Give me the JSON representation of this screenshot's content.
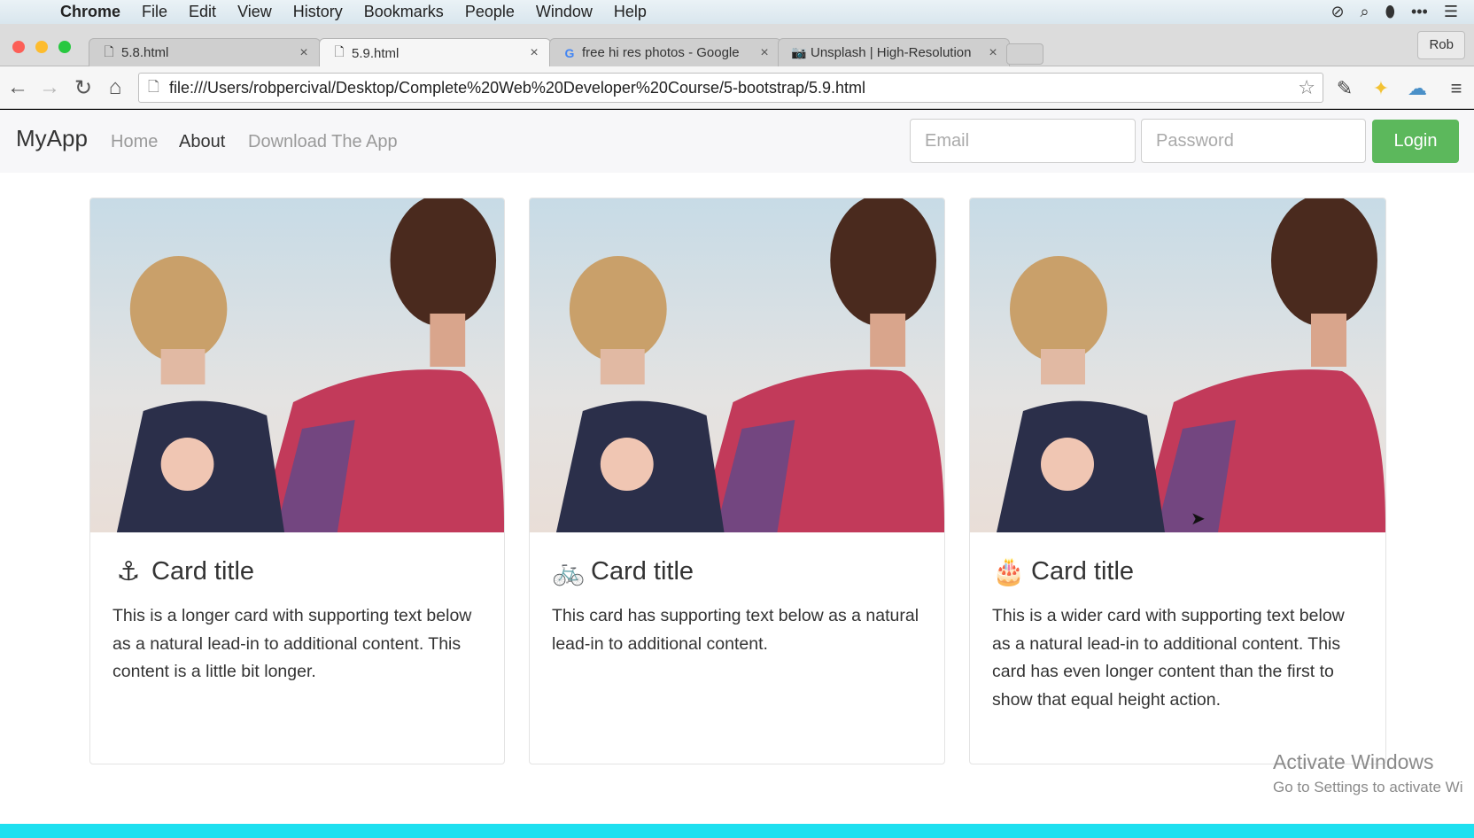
{
  "menubar": {
    "apple": "",
    "app_name": "Chrome",
    "items": [
      "File",
      "Edit",
      "View",
      "History",
      "Bookmarks",
      "People",
      "Window",
      "Help"
    ],
    "status_icons": [
      "⊘",
      "⌕",
      "⬮",
      "•••",
      "☰"
    ]
  },
  "tabs": [
    {
      "title": "5.8.html",
      "favicon": "🗋",
      "active": false
    },
    {
      "title": "5.9.html",
      "favicon": "🗋",
      "active": true
    },
    {
      "title": "free hi res photos - Google",
      "favicon": "G",
      "active": false
    },
    {
      "title": "Unsplash | High-Resolution",
      "favicon": "📷",
      "active": false
    }
  ],
  "tab_close": "×",
  "profile_name": "Rob",
  "toolbar": {
    "back": "←",
    "forward": "→",
    "reload": "↻",
    "home": "⌂",
    "page_icon": "🗋",
    "url": "file:///Users/robpercival/Desktop/Complete%20Web%20Developer%20Course/5-bootstrap/5.9.html",
    "star": "☆",
    "ext_icons": [
      "✎",
      "✦",
      "☁",
      "≡"
    ]
  },
  "site": {
    "brand": "MyApp",
    "nav": [
      "Home",
      "About",
      "Download The App"
    ],
    "email_placeholder": "Email",
    "password_placeholder": "Password",
    "login": "Login"
  },
  "cards": [
    {
      "icon": "⚓",
      "title": "Card title",
      "text": "This is a longer card with supporting text below as a natural lead-in to additional content. This content is a little bit longer."
    },
    {
      "icon": "🚲",
      "title": "Card title",
      "text": "This card has supporting text below as a natural lead-in to additional content."
    },
    {
      "icon": "🎂",
      "title": "Card title",
      "text": "This is a wider card with supporting text below as a natural lead-in to additional content. This card has even longer content than the first to show that equal height action."
    }
  ],
  "watermark": {
    "line1": "Activate Windows",
    "line2": "Go to Settings to activate Wi"
  },
  "colors": {
    "login_bg": "#5cb85c",
    "navbar_bg": "#f7f7f9",
    "bottom_strip": "#1ee0f0"
  }
}
